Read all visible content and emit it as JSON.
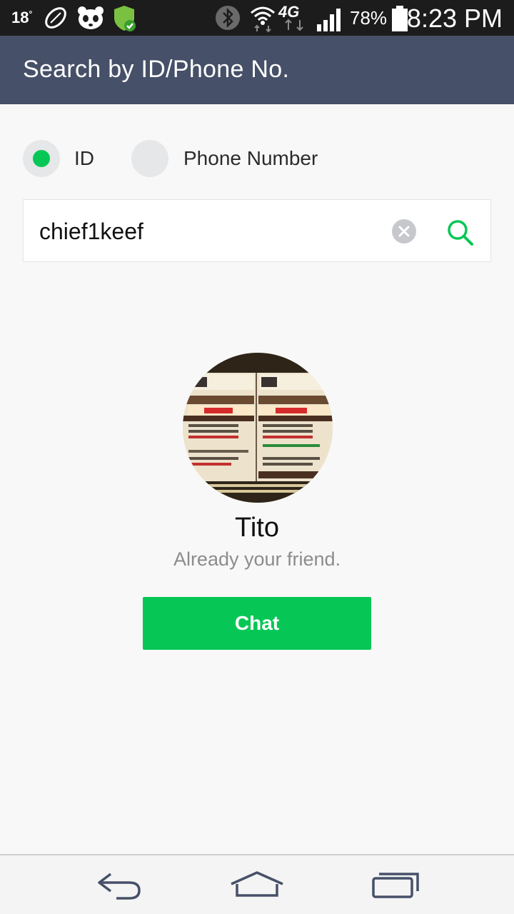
{
  "status_bar": {
    "temperature": "18",
    "degree": "°",
    "network": "4G",
    "battery_percent": "78%",
    "time": "8:23 PM",
    "icons": [
      "football-icon",
      "panda-icon",
      "shield-check-icon",
      "bluetooth-icon",
      "wifi-icon",
      "network-4g-icon",
      "signal-icon",
      "battery-icon"
    ]
  },
  "app_bar": {
    "title": "Search by ID/Phone No."
  },
  "search_type": {
    "options": [
      {
        "label": "ID",
        "selected": true
      },
      {
        "label": "Phone Number",
        "selected": false
      }
    ]
  },
  "search": {
    "value": "chief1keef"
  },
  "result": {
    "name": "Tito",
    "status": "Already your friend.",
    "action_label": "Chat"
  },
  "colors": {
    "app_bar": "#465068",
    "accent_green": "#06c755",
    "background": "#f8f8f8"
  },
  "nav_bar": {
    "icons": [
      "back-icon",
      "home-icon",
      "recents-icon"
    ]
  }
}
